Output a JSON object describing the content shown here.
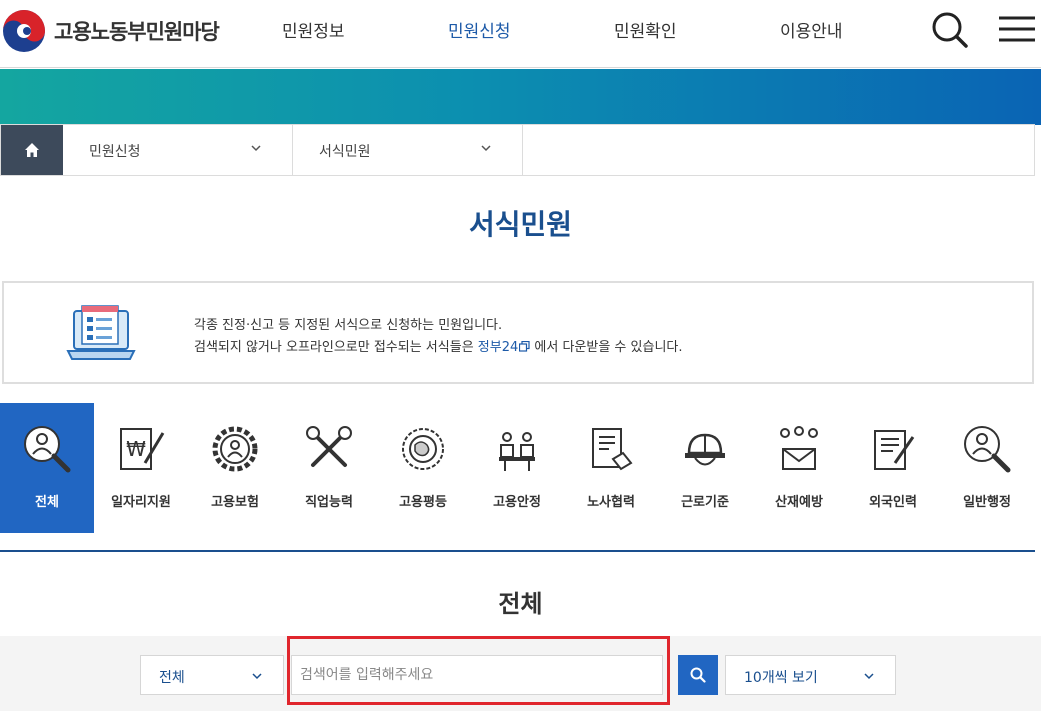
{
  "header": {
    "logo_text": "고용노동부민원마당",
    "nav": [
      {
        "label": "민원정보",
        "active": false
      },
      {
        "label": "민원신청",
        "active": true
      },
      {
        "label": "민원확인",
        "active": false
      },
      {
        "label": "이용안내",
        "active": false
      }
    ],
    "search_icon": "search-icon",
    "menu_icon": "hamburger-menu-icon"
  },
  "breadcrumb": {
    "home_icon": "home-icon",
    "level1": "민원신청",
    "level2": "서식민원"
  },
  "page_title": "서식민원",
  "info": {
    "line1": "각종 진정·신고 등 지정된 서식으로 신청하는 민원입니다.",
    "line2_before": "검색되지 않거나 오프라인으로만 접수되는 서식들은",
    "link_label": "정부24",
    "line2_after": "에서 다운받을 수 있습니다."
  },
  "categories": [
    {
      "label": "전체",
      "icon": "magnifier-person-icon",
      "active": true
    },
    {
      "label": "일자리지원",
      "icon": "won-document-pen-icon",
      "active": false
    },
    {
      "label": "고용보험",
      "icon": "gear-person-icon",
      "active": false
    },
    {
      "label": "직업능력",
      "icon": "tools-wrench-icon",
      "active": false
    },
    {
      "label": "고용평등",
      "icon": "globe-people-icon",
      "active": false
    },
    {
      "label": "고용안정",
      "icon": "meeting-table-icon",
      "active": false
    },
    {
      "label": "노사협력",
      "icon": "document-handshake-icon",
      "active": false
    },
    {
      "label": "근로기준",
      "icon": "hard-hat-icon",
      "active": false
    },
    {
      "label": "산재예방",
      "icon": "people-envelope-icon",
      "active": false
    },
    {
      "label": "외국인력",
      "icon": "form-pen-icon",
      "active": false
    },
    {
      "label": "일반행정",
      "icon": "magnifier-person-icon",
      "active": false
    }
  ],
  "section_title": "전체",
  "search": {
    "category_select": "전체",
    "placeholder": "검색어를 입력해주세요",
    "value": "",
    "page_size_select": "10개씩 보기"
  },
  "colors": {
    "primary": "#2166c2",
    "title": "#1a4f8e",
    "highlight": "#e0262d"
  }
}
